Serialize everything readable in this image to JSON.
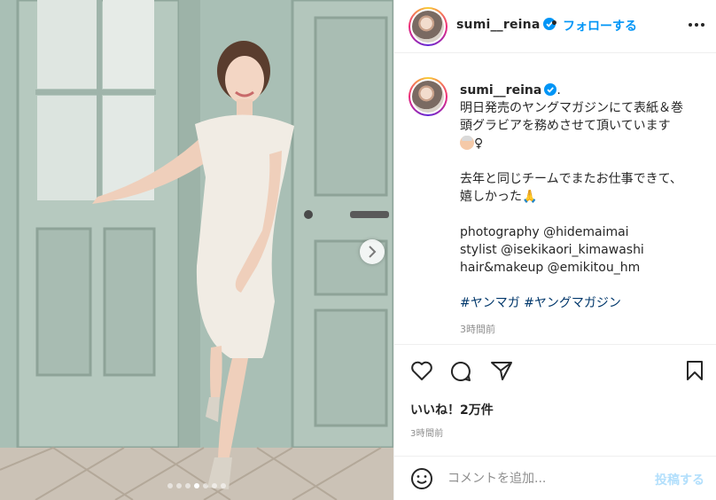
{
  "post": {
    "username": "sumi__reina",
    "verified_icon": "verified-badge-icon",
    "separator": "•",
    "follow_label": "フォローする",
    "more_icon": "more-options-icon"
  },
  "caption": {
    "username": "sumi__reina",
    "after_badge": ".",
    "lines": [
      "明日発売のヤングマガジンにて表紙＆巻",
      "頭グラビアを務めさせて頂いています",
      "♀",
      "",
      "去年と同じチームでまたお仕事できて、",
      "嬉しかった🙏",
      "",
      "photography @hidemaimai",
      "stylist @isekikaori_kimawashi",
      "hair&makeup @emikitou_hm",
      "",
      "#ヤンマガ #ヤングマガジン"
    ],
    "time": "3時間前"
  },
  "actions": {
    "like_icon": "heart-icon",
    "comment_icon": "comment-icon",
    "share_icon": "share-icon",
    "save_icon": "bookmark-icon"
  },
  "likes_text": "いいね！2万件",
  "timestamp": "3時間前",
  "comment": {
    "placeholder": "コメントを追加...",
    "post_label": "投稿する",
    "emoji_icon": "smile-icon"
  },
  "carousel": {
    "total_slides": 7,
    "active_index": 3,
    "next_icon": "chevron-right-icon"
  },
  "colors": {
    "accent": "#0095f6",
    "post_disabled": "#b2dffc",
    "muted": "#8e8e8e",
    "text": "#262626"
  }
}
